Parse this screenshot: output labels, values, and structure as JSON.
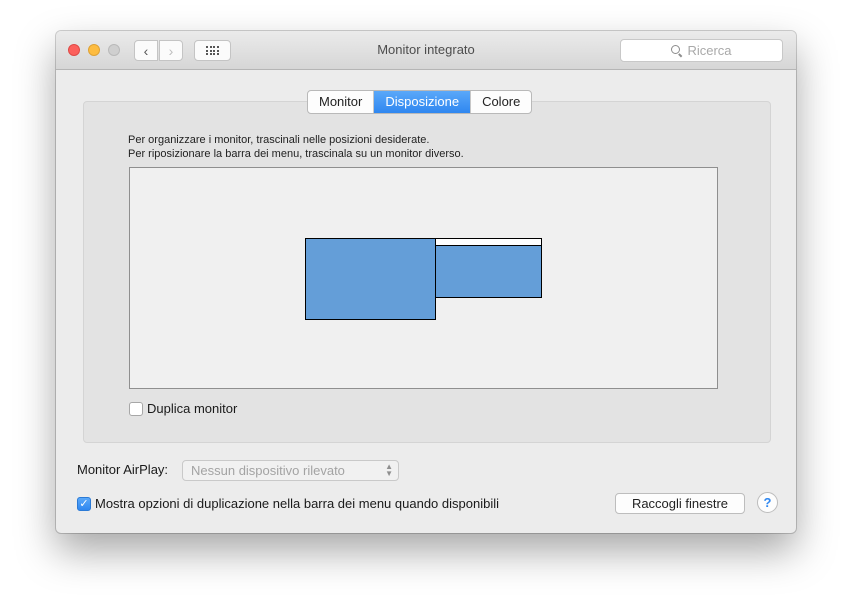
{
  "window": {
    "title": "Monitor integrato"
  },
  "toolbar": {
    "back_icon": "chevron-left-icon",
    "forward_icon": "chevron-right-icon",
    "show_all_icon": "grid-icon",
    "search_placeholder": "Ricerca"
  },
  "tabs": [
    {
      "label": "Monitor",
      "active": false
    },
    {
      "label": "Disposizione",
      "active": true
    },
    {
      "label": "Colore",
      "active": false
    }
  ],
  "arrangement": {
    "instruction_1": "Per organizzare i monitor, trascinali nelle posizioni desiderate.",
    "instruction_2": "Per riposizionare la barra dei menu, trascinala su un monitor diverso.",
    "display_color": "#649ed8",
    "mirror_displays": {
      "label": "Duplica monitor",
      "checked": false
    }
  },
  "airplay": {
    "label": "Monitor AirPlay:",
    "selected": "Nessun dispositivo rilevato",
    "enabled": false
  },
  "mirroring_menu": {
    "label": "Mostra opzioni di duplicazione nella barra dei menu quando disponibili",
    "checked": true
  },
  "buttons": {
    "gather_windows": "Raccogli finestre",
    "help": "?"
  },
  "colors": {
    "accent": "#2f87f0",
    "close": "#fc605c",
    "minimize": "#fdbc40",
    "zoom_disabled": "#cfcfcf"
  }
}
